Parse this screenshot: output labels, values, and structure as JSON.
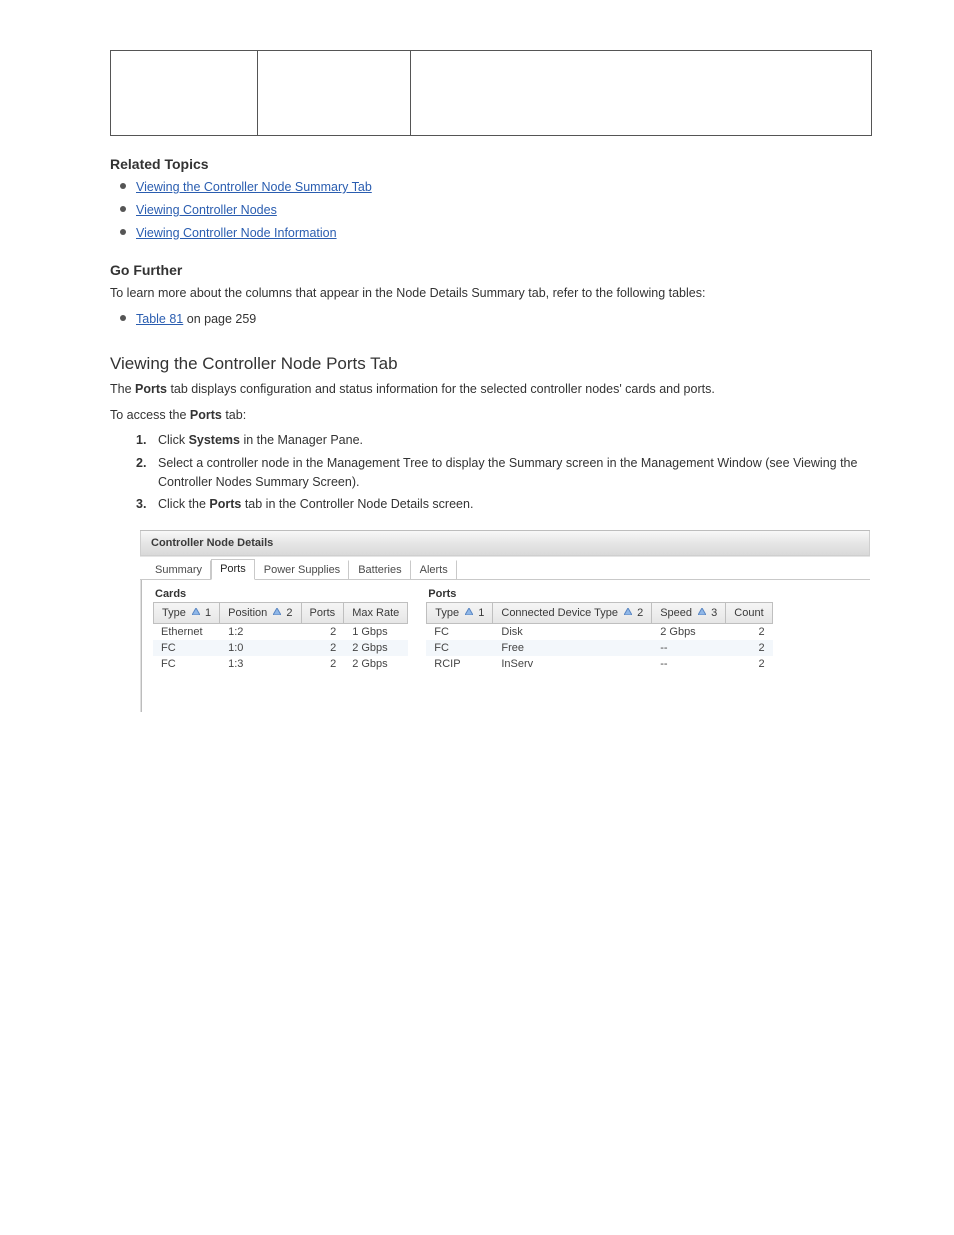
{
  "top_table": {
    "cells": [
      "",
      "",
      ""
    ]
  },
  "related_topics": {
    "heading": "Related Topics",
    "items": [
      "Viewing the Controller Node Summary Tab",
      "Viewing Controller Nodes",
      "Viewing Controller Node Information"
    ]
  },
  "go_further": {
    "heading": "Go Further",
    "body": "To learn more about the columns that appear in the Node Details Summary tab, refer to the following tables:",
    "items": [
      {
        "prefix": "Table 81",
        "rest": " on page 259"
      }
    ]
  },
  "ports": {
    "header": "Viewing the Controller Node Ports Tab",
    "intro_lead": "The ",
    "intro_term": "Ports",
    "intro_rest": " tab displays configuration and status information for the selected controller nodes' cards and ports.",
    "to_access_lead": "To access the ",
    "to_access_term": "Ports",
    "to_access_rest": " tab:",
    "steps": [
      {
        "n": "1.",
        "segments": [
          "Click ",
          "Systems",
          " in the Manager Pane."
        ]
      },
      {
        "n": "2.",
        "segments": [
          "Select a controller node in the Management Tree to display the Summary screen in the Management Window (see ",
          "Viewing the Controller Nodes Summary Screen",
          ")."
        ]
      },
      {
        "n": "3.",
        "segments": [
          "Click the ",
          "Ports",
          " tab in the Controller Node Details screen."
        ]
      }
    ]
  },
  "panel": {
    "title": "Controller Node Details",
    "tabs": [
      "Summary",
      "Ports",
      "Power Supplies",
      "Batteries",
      "Alerts"
    ],
    "active_tab_index": 1,
    "cards": {
      "heading": "Cards",
      "columns": [
        "Type",
        "Position",
        "Ports",
        "Max Rate"
      ],
      "sort_nums": [
        "1",
        "2",
        "",
        ""
      ],
      "rows": [
        {
          "type": "Ethernet",
          "position": "1:2",
          "ports": "2",
          "max_rate": "1 Gbps"
        },
        {
          "type": "FC",
          "position": "1:0",
          "ports": "2",
          "max_rate": "2 Gbps"
        },
        {
          "type": "FC",
          "position": "1:3",
          "ports": "2",
          "max_rate": "2 Gbps"
        }
      ]
    },
    "ports_table": {
      "heading": "Ports",
      "columns": [
        "Type",
        "Connected Device Type",
        "Speed",
        "Count"
      ],
      "sort_nums": [
        "1",
        "2",
        "3",
        ""
      ],
      "rows": [
        {
          "type": "FC",
          "cdt": "Disk",
          "speed": "2 Gbps",
          "count": "2"
        },
        {
          "type": "FC",
          "cdt": "Free",
          "speed": "--",
          "count": "2"
        },
        {
          "type": "RCIP",
          "cdt": "InServ",
          "speed": "--",
          "count": "2"
        }
      ]
    }
  }
}
